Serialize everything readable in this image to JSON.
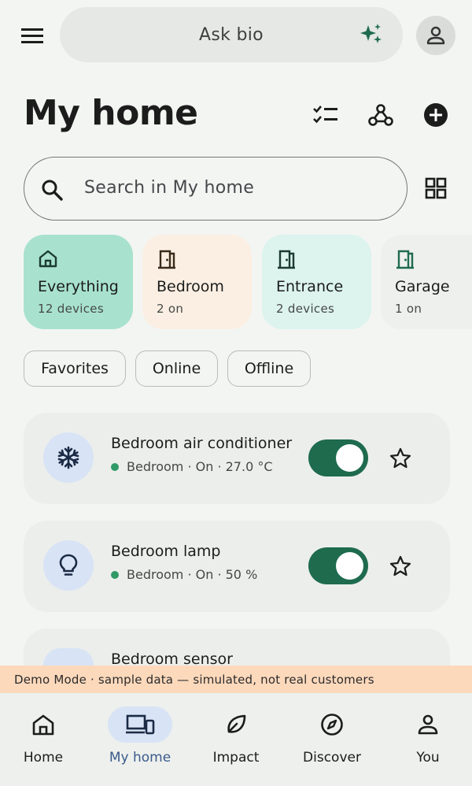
{
  "colors": {
    "accent_green": "#1e6b4e",
    "status_online": "#2f9a66",
    "nav_active_bg": "#d8e3f5",
    "banner_bg": "#fdd9bc"
  },
  "topbar": {
    "menu_icon": "hamburger-menu-icon",
    "ask_placeholder": "Ask bio",
    "sparkle_icon": "sparkle-icon",
    "account_icon": "person-icon"
  },
  "page": {
    "title": "My home",
    "actions": [
      "checklist-icon",
      "automation-icon",
      "add-circle-icon"
    ]
  },
  "search": {
    "placeholder": "Search in My home",
    "grid_icon": "grid-view-icon"
  },
  "rooms": [
    {
      "name": "Everything",
      "subtitle": "12 devices",
      "icon": "home-icon",
      "color": "#a8e2cf"
    },
    {
      "name": "Bedroom",
      "subtitle": "2 on",
      "icon": "door-icon",
      "color": "#fbefe3"
    },
    {
      "name": "Entrance",
      "subtitle": "2 devices",
      "icon": "door-icon",
      "color": "#dcf3ee"
    },
    {
      "name": "Garage",
      "subtitle": "1 on",
      "icon": "door-icon",
      "color": "#eef0ee"
    }
  ],
  "filters": [
    "Favorites",
    "Online",
    "Offline"
  ],
  "devices": [
    {
      "name": "Bedroom air conditioner",
      "status": "Bedroom · On · 27.0 °C",
      "icon": "snowflake-icon",
      "on": true
    },
    {
      "name": "Bedroom lamp",
      "status": "Bedroom · On · 50 %",
      "icon": "lightbulb-icon",
      "on": true
    },
    {
      "name": "Bedroom sensor",
      "status": "",
      "icon": "sensor-icon",
      "on": false
    }
  ],
  "banner": {
    "text": "Demo Mode · sample data — simulated, not real customers"
  },
  "bottom_nav": [
    {
      "label": "Home",
      "icon": "home-icon",
      "active": false
    },
    {
      "label": "My home",
      "icon": "devices-icon",
      "active": true
    },
    {
      "label": "Impact",
      "icon": "leaf-icon",
      "active": false
    },
    {
      "label": "Discover",
      "icon": "compass-icon",
      "active": false
    },
    {
      "label": "You",
      "icon": "person-icon",
      "active": false
    }
  ]
}
